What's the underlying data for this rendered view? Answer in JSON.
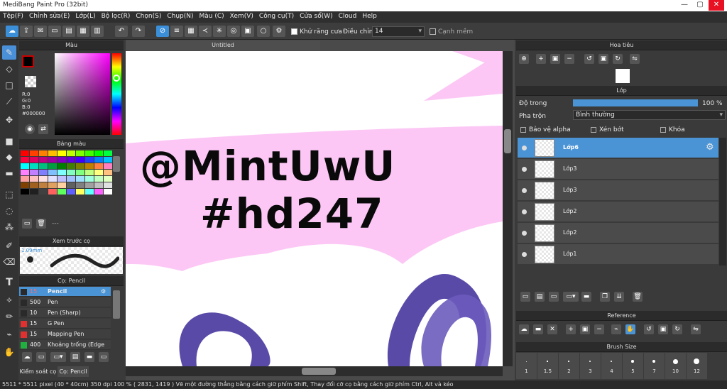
{
  "app": {
    "title": "MediBang Paint Pro (32bit)"
  },
  "menu": [
    "Tệp(F)",
    "Chỉnh sửa(E)",
    "Lớp(L)",
    "Bộ lọc(R)",
    "Chọn(S)",
    "Chụp(N)",
    "Màu (C)",
    "Xem(V)",
    "Công cụ(T)",
    "Cửa sổ(W)",
    "Cloud",
    "Help"
  ],
  "toolbar": {
    "antialias_label": "Khử răng cưa",
    "correction_label": "Điều chỉnh",
    "correction_value": "14",
    "sharp_edge_label": "Cạnh mềm"
  },
  "canvas": {
    "tab_label": "Untitled",
    "drawing_text_line1": "@MintUwU",
    "drawing_text_line2": "#hd247"
  },
  "color_panel": {
    "title": "Màu",
    "r": "R:0",
    "g": "G:0",
    "b": "B:0",
    "hex": "#000000"
  },
  "palette_panel": {
    "title": "Bảng màu",
    "dash": "---",
    "swatches": [
      "#ff0000",
      "#ff4000",
      "#ff8000",
      "#ffbf00",
      "#ffff00",
      "#bfff00",
      "#80ff00",
      "#40ff00",
      "#00ff00",
      "#00ff40",
      "#ff0040",
      "#e00060",
      "#c00080",
      "#a000a0",
      "#8000c0",
      "#6000e0",
      "#4000ff",
      "#2040ff",
      "#0080ff",
      "#00c0ff",
      "#00ffff",
      "#00e0c0",
      "#00c080",
      "#00a040",
      "#008000",
      "#408000",
      "#808000",
      "#c08000",
      "#ff8040",
      "#ff80c0",
      "#ff80ff",
      "#c080ff",
      "#8080ff",
      "#80c0ff",
      "#80ffff",
      "#80ffc0",
      "#80ff80",
      "#c0ff80",
      "#ffff80",
      "#ffc080",
      "#ffa0a0",
      "#ffc0c0",
      "#ffe0e0",
      "#e0e0ff",
      "#c0c0ff",
      "#a0c0ff",
      "#a0e0ff",
      "#a0ffe0",
      "#c0ffc0",
      "#e0ffc0",
      "#804000",
      "#a06020",
      "#c08040",
      "#e0a060",
      "#ffd0a0",
      "#606060",
      "#808080",
      "#a0a0a0",
      "#c0c0c0",
      "#e0e0e0",
      "#000000",
      "#202020",
      "#404040",
      "#ff6060",
      "#60ff60",
      "#6060ff",
      "#ffff60",
      "#60ffff",
      "#ff60ff",
      "#ffffff"
    ]
  },
  "brush_preview": {
    "title": "Xem trước cọ",
    "size": "1.09mm"
  },
  "brush_panel": {
    "title": "Cọ: Pencil",
    "brushes": [
      {
        "size": "15",
        "name": "Pencil",
        "color": "#2a2a2a"
      },
      {
        "size": "500",
        "name": "Pen",
        "color": "#2a2a2a"
      },
      {
        "size": "10",
        "name": "Pen (Sharp)",
        "color": "#2a2a2a"
      },
      {
        "size": "15",
        "name": "G Pen",
        "color": "#e03030"
      },
      {
        "size": "15",
        "name": "Mapping Pen",
        "color": "#e03030"
      },
      {
        "size": "400",
        "name": "Khoảng trống (Edge",
        "color": "#20b040"
      }
    ],
    "tab_control": "Kiểm soát cọ",
    "tab_brush": "Cọ: Pencil"
  },
  "navigator": {
    "title": "Hoa tiêu"
  },
  "layer_panel": {
    "title": "Lớp",
    "opacity_label": "Độ trong",
    "opacity_value": "100 %",
    "opacity": 1.0,
    "blend_label": "Pha trộn",
    "blend_value": "Bình thường",
    "protect_alpha": "Bảo vệ alpha",
    "clip": "Xén bớt",
    "lock": "Khóa",
    "layers": [
      {
        "name": "Lớp6",
        "selected": true
      },
      {
        "name": "Lớp3",
        "selected": false
      },
      {
        "name": "Lớp3",
        "selected": false
      },
      {
        "name": "Lớp2",
        "selected": false
      },
      {
        "name": "Lớp2",
        "selected": false
      },
      {
        "name": "Lớp1",
        "selected": false
      }
    ]
  },
  "reference_panel": {
    "title": "Reference"
  },
  "brush_size_panel": {
    "title": "Brush Size",
    "sizes": [
      "1",
      "1.5",
      "2",
      "3",
      "4",
      "5",
      "7",
      "10",
      "12"
    ]
  },
  "status": {
    "text": "5511 * 5511 pixel  (40 * 40cm)  350 dpi  100 %  ( 2831, 1419 )  Vẽ một đường thẳng bằng cách giữ phím Shift, Thay đổi cỡ cọ bằng cách giữ phím Ctrl, Alt và kéo"
  }
}
